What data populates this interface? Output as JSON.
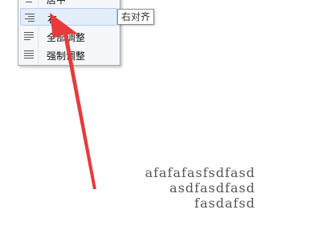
{
  "menu": {
    "items": [
      {
        "label": "居中",
        "icon": "align-center-icon"
      },
      {
        "label": "右",
        "icon": "align-right-icon"
      },
      {
        "label": "全部调整",
        "icon": "justify-icon"
      },
      {
        "label": "强制调整",
        "icon": "distribute-icon"
      }
    ],
    "selected_index": 1
  },
  "tooltip": {
    "text": "右对齐"
  },
  "document": {
    "lines": [
      "afafafasfsdfasd",
      "asdfasdfasd",
      "fasdafsd"
    ],
    "alignment": "right"
  },
  "annotation": {
    "shape": "arrow",
    "color": "#e83a3a"
  }
}
